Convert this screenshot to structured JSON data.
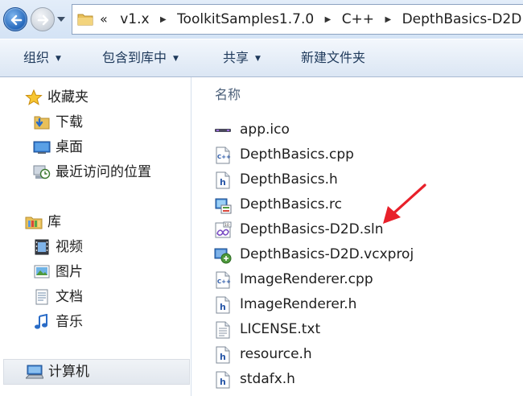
{
  "address_bar": {
    "overflow": "«",
    "crumbs": [
      "v1.x",
      "ToolkitSamples1.7.0",
      "C++",
      "DepthBasics-D2D"
    ]
  },
  "toolbar": {
    "organize": "组织",
    "include_library": "包含到库中",
    "share": "共享",
    "new_folder": "新建文件夹"
  },
  "nav": {
    "favorites": "收藏夹",
    "downloads": "下载",
    "desktop": "桌面",
    "recent": "最近访问的位置",
    "libraries": "库",
    "videos": "视频",
    "pictures": "图片",
    "documents": "文档",
    "music": "音乐",
    "computer": "计算机"
  },
  "content": {
    "column_name": "名称",
    "files": [
      {
        "name": "app.ico",
        "icon": "ico-file-icon"
      },
      {
        "name": "DepthBasics.cpp",
        "icon": "cpp-file-icon"
      },
      {
        "name": "DepthBasics.h",
        "icon": "h-file-icon"
      },
      {
        "name": "DepthBasics.rc",
        "icon": "rc-file-icon"
      },
      {
        "name": "DepthBasics-D2D.sln",
        "icon": "sln-file-icon"
      },
      {
        "name": "DepthBasics-D2D.vcxproj",
        "icon": "vcxproj-file-icon"
      },
      {
        "name": "ImageRenderer.cpp",
        "icon": "cpp-file-icon"
      },
      {
        "name": "ImageRenderer.h",
        "icon": "h-file-icon"
      },
      {
        "name": "LICENSE.txt",
        "icon": "txt-file-icon"
      },
      {
        "name": "resource.h",
        "icon": "h-file-icon"
      },
      {
        "name": "stdafx.h",
        "icon": "h-file-icon"
      }
    ]
  },
  "colors": {
    "annotation_arrow": "#e8202a",
    "toolbar_text": "#1e395b",
    "header_text": "#4c607a"
  }
}
